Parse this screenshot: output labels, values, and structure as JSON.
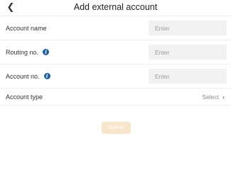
{
  "header": {
    "title": "Add external account",
    "back_icon": "chevron-left-icon"
  },
  "form": {
    "account_name": {
      "label": "Account name",
      "placeholder": "Enter",
      "value": ""
    },
    "routing_no": {
      "label": "Routing no.",
      "placeholder": "Enter",
      "value": "",
      "info_icon": "info-icon"
    },
    "account_no": {
      "label": "Account no.",
      "placeholder": "Enter",
      "value": "",
      "info_icon": "info-icon"
    },
    "account_type": {
      "label": "Account type",
      "select_label": "Select",
      "chevron_icon": "chevron-right-icon"
    }
  },
  "submit": {
    "label": "Submit"
  },
  "colors": {
    "info_icon": "#1f5fa8",
    "input_background": "#f1f1f1",
    "submit_background": "#f8e6cc",
    "divider": "#ececec"
  }
}
